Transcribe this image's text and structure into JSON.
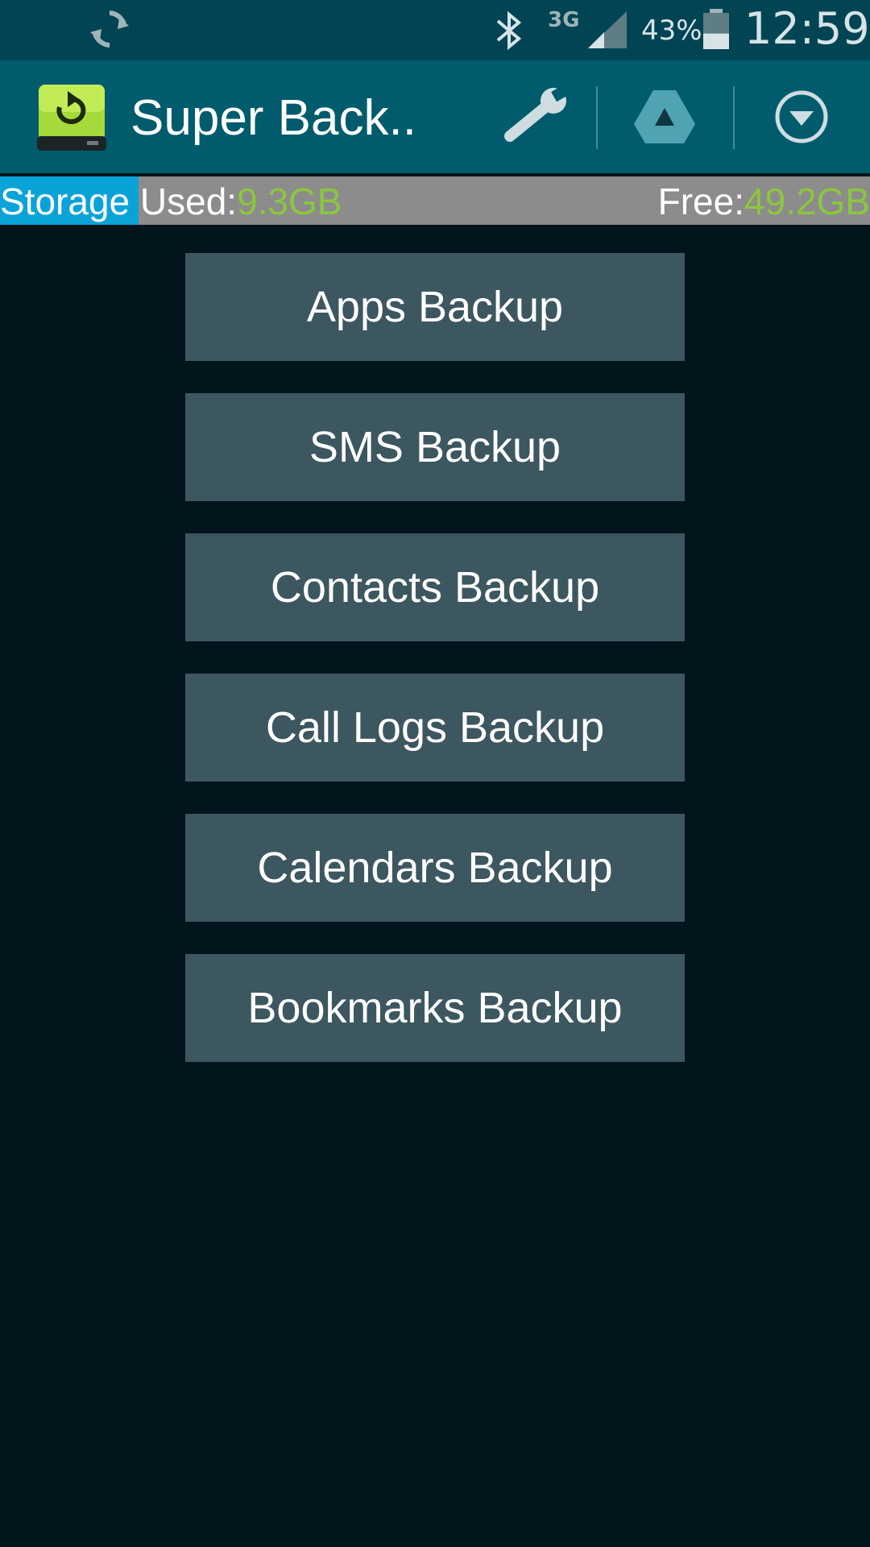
{
  "status_bar": {
    "network": "3G",
    "battery_percent": "43%",
    "battery_level": 0.43,
    "time": "12:59"
  },
  "action_bar": {
    "title": "Super Back..",
    "icons": [
      "app-logo-icon",
      "wrench-icon",
      "google-drive-icon",
      "overflow-menu-icon"
    ]
  },
  "storage": {
    "used_label": "Storage Used:",
    "used_value": "9.3GB",
    "free_label": "Free:",
    "free_value": "49.2GB",
    "used_fraction": 0.159
  },
  "buttons": [
    {
      "label": "Apps Backup"
    },
    {
      "label": "SMS Backup"
    },
    {
      "label": "Contacts Backup"
    },
    {
      "label": "Call Logs Backup"
    },
    {
      "label": "Calendars Backup"
    },
    {
      "label": "Bookmarks Backup"
    }
  ],
  "colors": {
    "status_bar": "#014555",
    "action_bar": "#005b6d",
    "background": "#02141c",
    "button": "#3d5760",
    "storage_fill": "#0aa3d8",
    "storage_track": "#8c8c8c",
    "accent_green": "#8cc63e"
  }
}
